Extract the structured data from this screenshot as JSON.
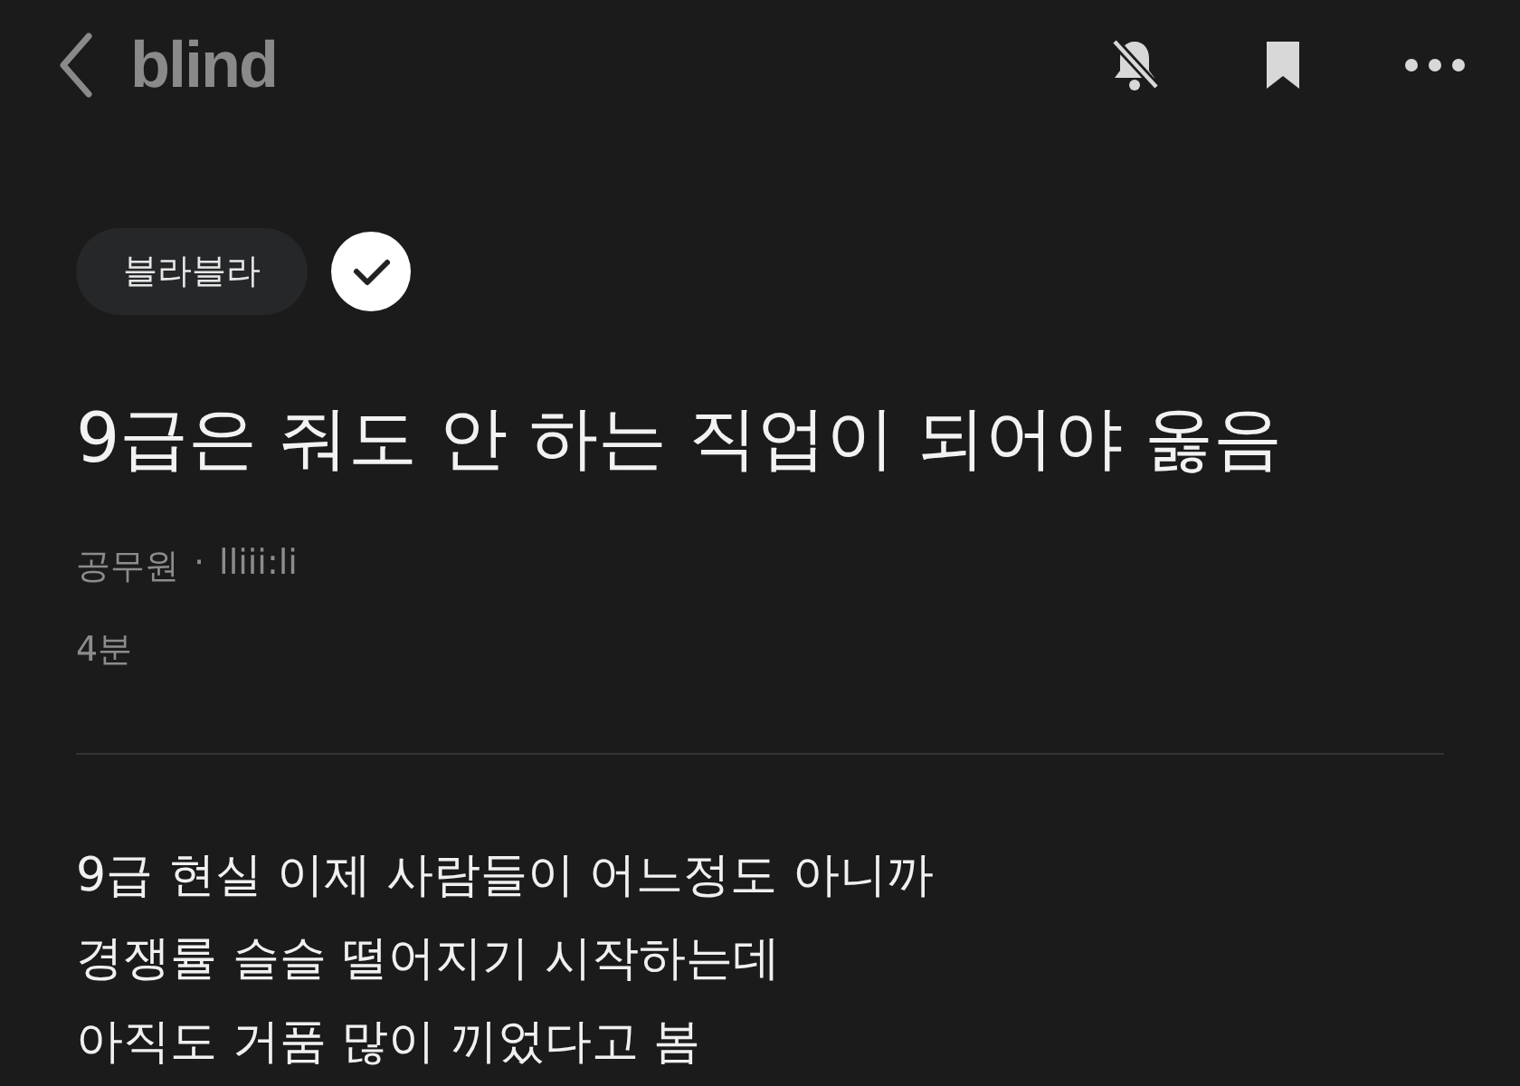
{
  "header": {
    "logo": "blind"
  },
  "post": {
    "board": "블라블라",
    "verified": true,
    "title": "9급은 줘도 안 하는 직업이 되어야 옳음",
    "company": "공무원",
    "separator": "·",
    "author": "lliii:li",
    "time": "4분",
    "body_lines": [
      "9급 현실 이제 사람들이 어느정도 아니까",
      "경쟁률 슬슬 떨어지기 시작하는데",
      "아직도 거품 많이 끼었다고 봄"
    ]
  }
}
